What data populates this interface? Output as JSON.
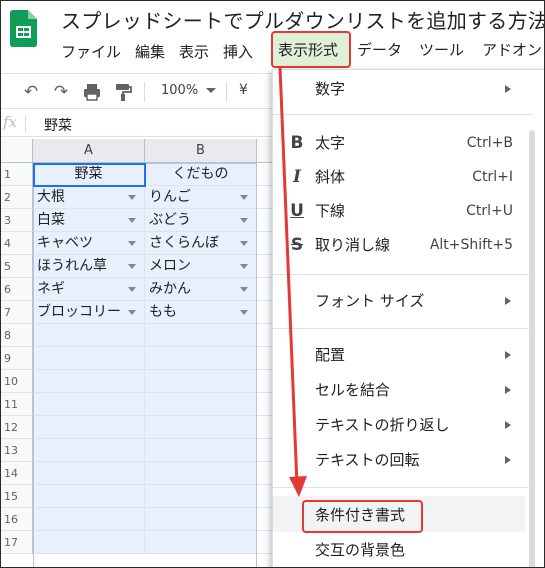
{
  "doc_title": "スプレッドシートでプルダウンリストを追加する方法",
  "menu": {
    "file": "ファイル",
    "edit": "編集",
    "view": "表示",
    "insert": "挿入",
    "format": "表示形式",
    "data": "データ",
    "tools": "ツール",
    "addons": "アドオン"
  },
  "toolbar": {
    "zoom": "100%",
    "currency": "¥"
  },
  "formula_bar": {
    "fx": "fx",
    "content": "野菜"
  },
  "grid": {
    "columns": [
      "A",
      "B"
    ],
    "rows": [
      "1",
      "2",
      "3",
      "4",
      "5",
      "6",
      "7",
      "8",
      "9",
      "10",
      "11",
      "12",
      "13",
      "14",
      "15",
      "16",
      "17"
    ],
    "col_a": [
      "野菜",
      "大根",
      "白菜",
      "キャベツ",
      "ほうれん草",
      "ネギ",
      "ブロッコリー"
    ],
    "col_b": [
      "くだもの",
      "りんご",
      "ぶどう",
      "さくらんぼ",
      "メロン",
      "みかん",
      "もも"
    ]
  },
  "format_menu": {
    "number": "数字",
    "bold": "太字",
    "bold_shortcut": "Ctrl+B",
    "italic": "斜体",
    "italic_shortcut": "Ctrl+I",
    "underline": "下線",
    "underline_shortcut": "Ctrl+U",
    "strikethrough": "取り消し線",
    "strikethrough_shortcut": "Alt+Shift+5",
    "font_size": "フォント サイズ",
    "align": "配置",
    "merge": "セルを結合",
    "wrap": "テキストの折り返し",
    "rotate": "テキストの回転",
    "conditional_formatting": "条件付き書式",
    "alternating_colors": "交互の背景色"
  },
  "colors": {
    "highlight_red": "#e53935",
    "format_menu_bg": "#dff0d8",
    "selection_fill": "#e8f0fe",
    "sheets_green": "#0f9d58"
  }
}
